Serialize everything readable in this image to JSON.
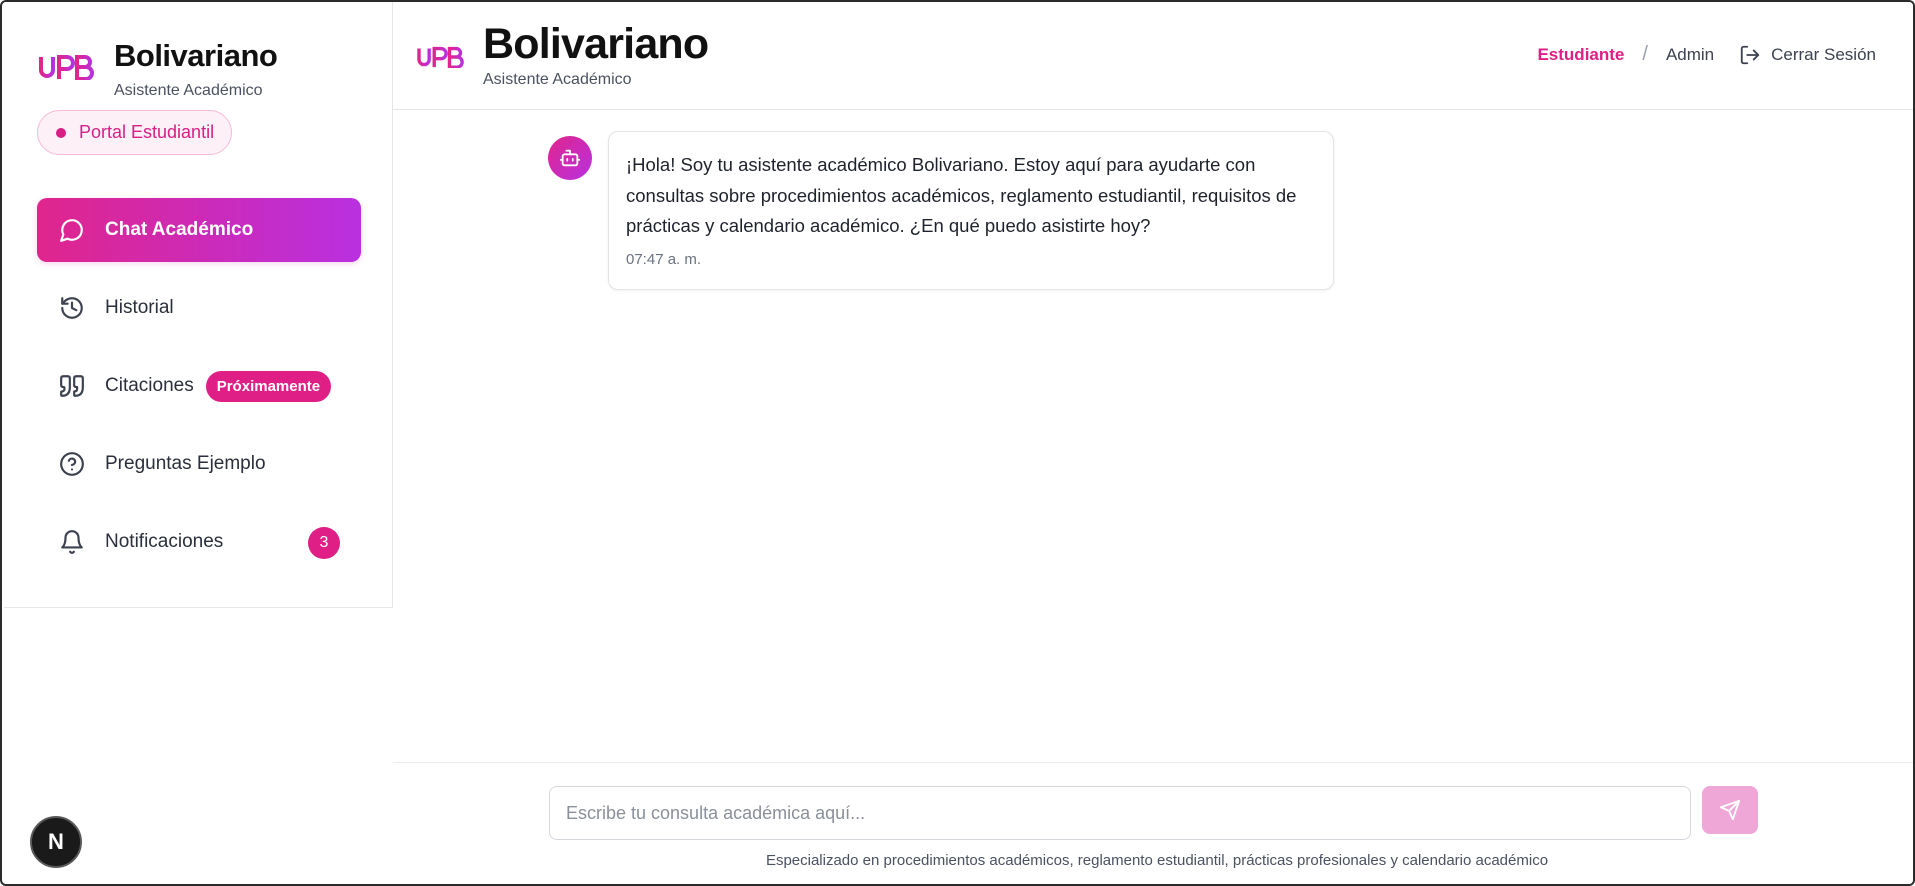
{
  "sidebar": {
    "brand_title": "Bolivariano",
    "brand_subtitle": "Asistente Académico",
    "portal_badge": "Portal Estudiantil",
    "items": [
      {
        "label": "Chat Académico",
        "icon": "chat-bubble-icon",
        "active": true
      },
      {
        "label": "Historial",
        "icon": "history-icon"
      },
      {
        "label": "Citaciones",
        "icon": "quote-icon",
        "pill": "Próximamente"
      },
      {
        "label": "Preguntas Ejemplo",
        "icon": "help-circle-icon"
      },
      {
        "label": "Notificaciones",
        "icon": "bell-icon",
        "count": "3"
      }
    ]
  },
  "header": {
    "title": "Bolivariano",
    "subtitle": "Asistente Académico",
    "nav_student": "Estudiante",
    "nav_separator": "/",
    "nav_admin": "Admin",
    "logout_label": "Cerrar Sesión"
  },
  "chat": {
    "messages": [
      {
        "sender": "bot",
        "text": "¡Hola! Soy tu asistente académico Bolivariano. Estoy aquí para ayudarte con consultas sobre procedimientos académicos, reglamento estudiantil, requisitos de prácticas y calendario académico. ¿En qué puedo asistirte hoy?",
        "time": "07:47 a. m."
      }
    ]
  },
  "composer": {
    "placeholder": "Escribe tu consulta académica aquí...",
    "value": "",
    "hint": "Especializado en procedimientos académicos, reglamento estudiantil, prácticas profesionales y calendario académico"
  },
  "dev_badge": "N",
  "colors": {
    "accent": "#df1f85",
    "gradient_start": "#e0258c",
    "gradient_end": "#b930e0",
    "send_button": "#eea7d6"
  }
}
